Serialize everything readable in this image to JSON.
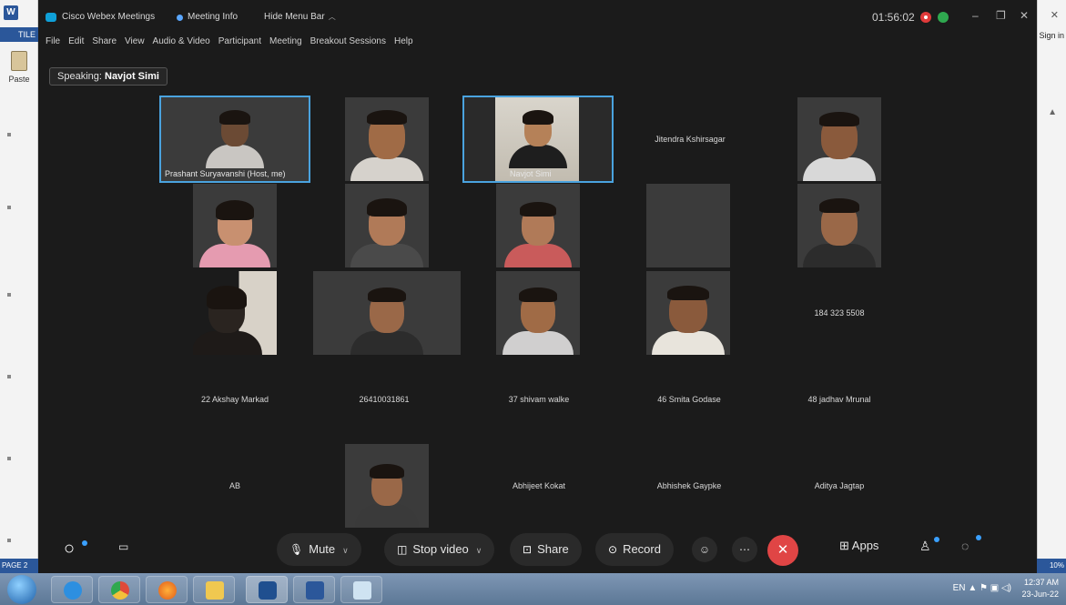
{
  "word": {
    "app_letter": "W",
    "file_tab": "TILE",
    "paste_label": "Paste",
    "page_status": "PAGE 2",
    "zoom_status": "10%",
    "sign_in": "Sign in"
  },
  "window": {
    "app_title": "Cisco Webex Meetings",
    "meeting_info": "Meeting Info",
    "hide_menu": "Hide Menu Bar",
    "timer": "01:56:02",
    "minimize": "–",
    "maximize": "❐",
    "close": "✕"
  },
  "menu": [
    "File",
    "Edit",
    "Share",
    "View",
    "Audio & Video",
    "Participant",
    "Meeting",
    "Breakout Sessions",
    "Help"
  ],
  "speaking": {
    "label": "Speaking:",
    "name": "Navjot Simi"
  },
  "participants": {
    "host": "Prashant Suryavanshi (Host, me)",
    "navjot": "Navjot Simi",
    "jitendra": "Jitendra Kshirsagar",
    "phone": "184 323 5508",
    "akshay": "22 Akshay Markad",
    "num": "26410031861",
    "shivam": "37 shivam walke",
    "smita": "46 Smita Godase",
    "mrunal": "48 jadhav Mrunal",
    "ab": "AB",
    "abhijeet": "Abhijeet Kokat",
    "abhishek": "Abhishek Gaypke",
    "aditya": "Aditya Jagtap"
  },
  "toolbar": {
    "mute": "Mute",
    "stop_video": "Stop video",
    "share": "Share",
    "record": "Record",
    "apps": "Apps"
  },
  "taskbar": {
    "tray_lang": "EN",
    "time": "12:37 AM",
    "date": "23-Jun-22"
  },
  "colors": {
    "webex_bg": "#1b1b1b",
    "active_border": "#4aa3df",
    "end_call": "#e04545",
    "record_indicator": "#e03a3a",
    "secure_indicator": "#2fa84f"
  }
}
